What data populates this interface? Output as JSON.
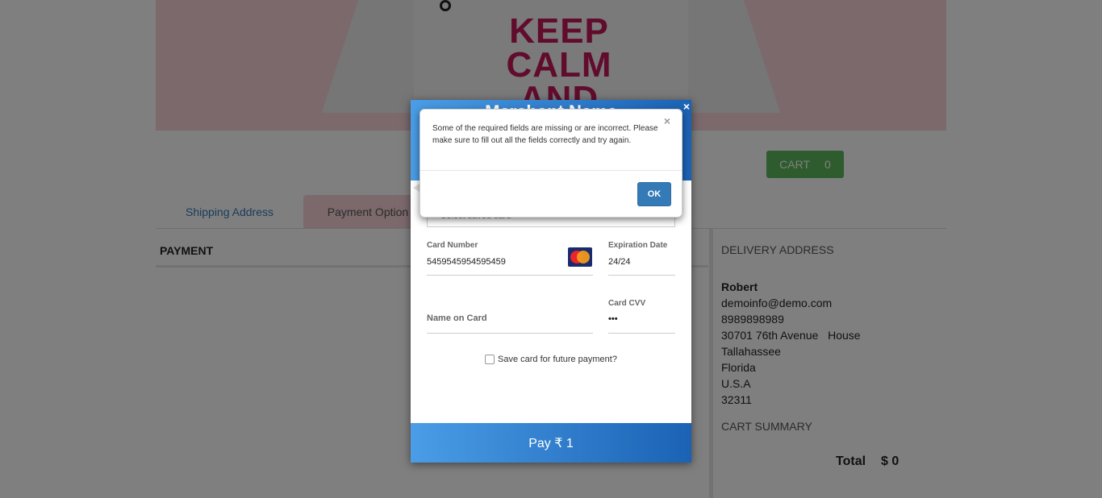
{
  "hero": {
    "shirt_text_line1": "KEEP",
    "shirt_text_line2": "CALM",
    "shirt_text_line3": "AND"
  },
  "cart": {
    "label": "CART",
    "count": "0"
  },
  "tabs": [
    {
      "label": "Shipping Address"
    },
    {
      "label": "Payment Option"
    }
  ],
  "payment": {
    "heading": "PAYMENT"
  },
  "delivery": {
    "title": "DELIVERY ADDRESS",
    "name": "Robert",
    "email": "demoinfo@demo.com",
    "phone": "8989898989",
    "street": "30701 76th Avenue   House",
    "city": "Tallahassee",
    "state": "Florida",
    "country": "U.S.A",
    "zip": "32311"
  },
  "summary": {
    "title": "CART SUMMARY",
    "total_label": "Total",
    "total_value": "$ 0"
  },
  "checkout": {
    "merchant_name": "Merchant Name",
    "close_symbol": "×",
    "saved_card_placeholder": "Select saved card",
    "card_number_label": "Card Number",
    "card_number_value": "5459545954595459",
    "card_brand": "mastercard-icon",
    "expiry_label": "Expiration Date",
    "expiry_value": "24/24",
    "name_label": "Name on Card",
    "cvv_label": "Card CVV",
    "cvv_value": "•••",
    "save_card_label": "Save card for future payment?",
    "save_card_checked": false,
    "pay_label": "Pay ₹ 1"
  },
  "alert": {
    "message": "Some of the required fields are missing or are incorrect. Please make sure to fill out all the fields correctly and try again.",
    "close_symbol": "×",
    "ok_label": "OK"
  },
  "colors": {
    "accent_blue": "#337ab7",
    "cart_green": "#5cb85c",
    "tab_pink": "#f7d3d9",
    "brand_text": "#c2185b"
  }
}
